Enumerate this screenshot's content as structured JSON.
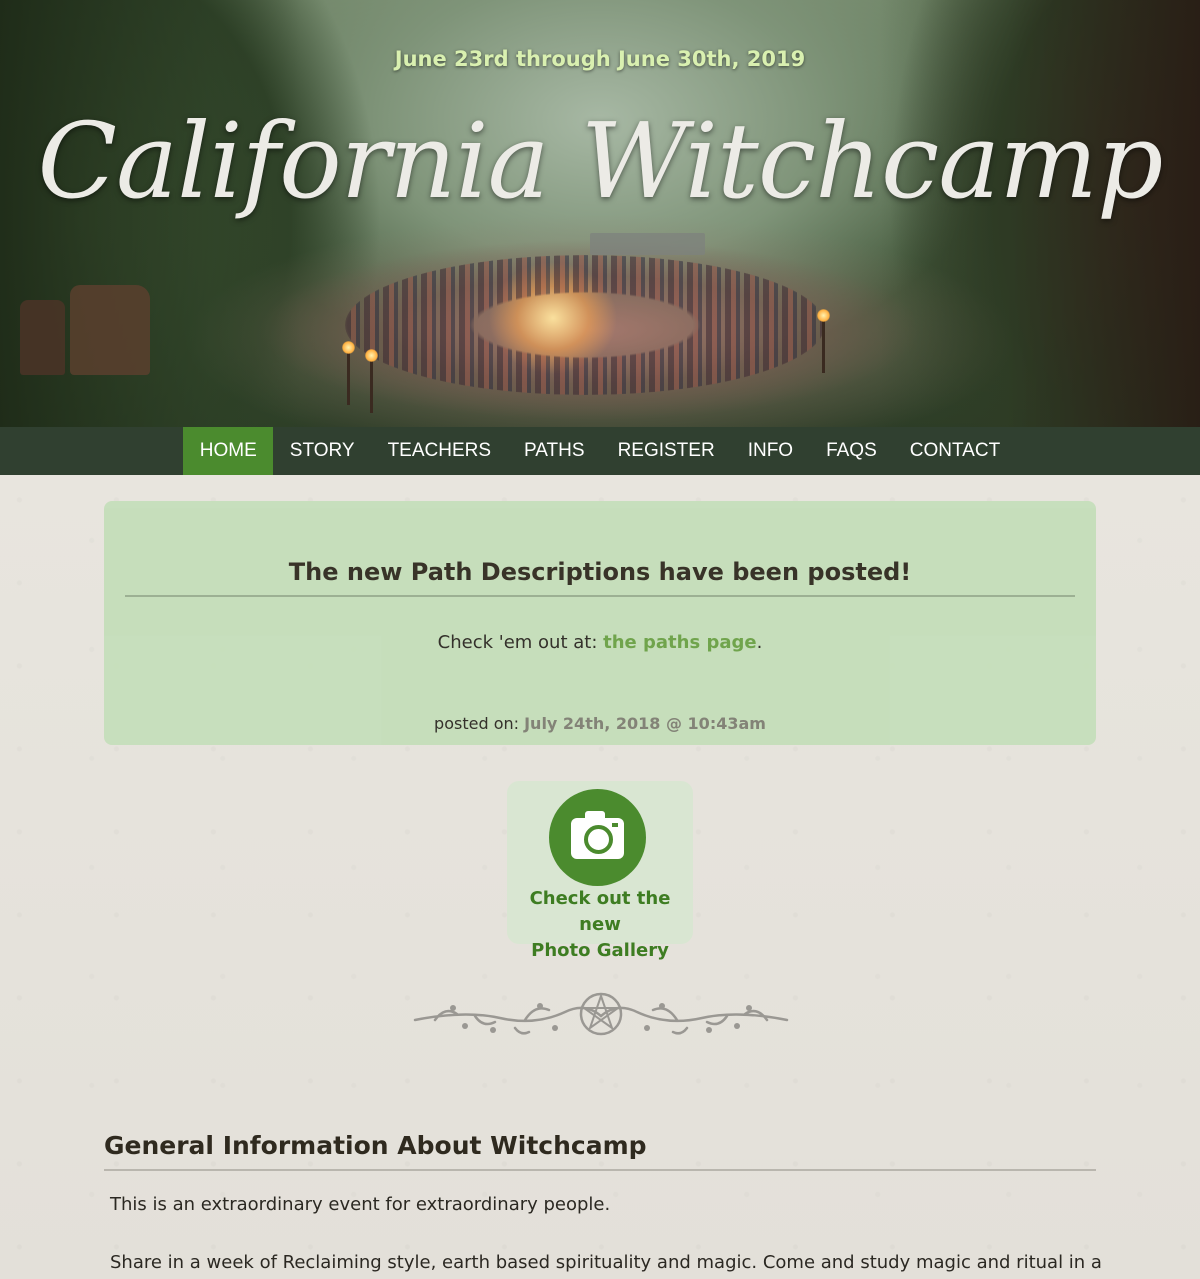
{
  "hero": {
    "dates": "June 23rd through June 30th, 2019",
    "title": "California Witchcamp"
  },
  "nav": {
    "items": [
      {
        "label": "HOME",
        "active": true
      },
      {
        "label": "STORY"
      },
      {
        "label": "TEACHERS"
      },
      {
        "label": "PATHS"
      },
      {
        "label": "REGISTER"
      },
      {
        "label": "INFO"
      },
      {
        "label": "FAQS"
      },
      {
        "label": "CONTACT"
      }
    ]
  },
  "announcement": {
    "heading": "The new Path Descriptions have been posted!",
    "message_prefix": "Check 'em out at: ",
    "message_link": "the paths page",
    "message_suffix": ".",
    "posted_prefix": "posted on: ",
    "posted_date": "July 24th, 2018 @ 10:43am"
  },
  "gallery": {
    "line1": "Check out the new",
    "line2": "Photo Gallery",
    "icon": "camera-icon"
  },
  "info": {
    "heading": "General Information About Witchcamp",
    "p1": "This is an extraordinary event for extraordinary people.",
    "p2": "Share in a week of Reclaiming style, earth based spirituality and magic. Come and study magic and ritual in a"
  },
  "colors": {
    "nav_bg": "#304030",
    "accent_green": "#4b8b2e",
    "announce_bg": "#c5deba",
    "link_green": "#6aa145",
    "date_text": "#d9f0b0"
  }
}
